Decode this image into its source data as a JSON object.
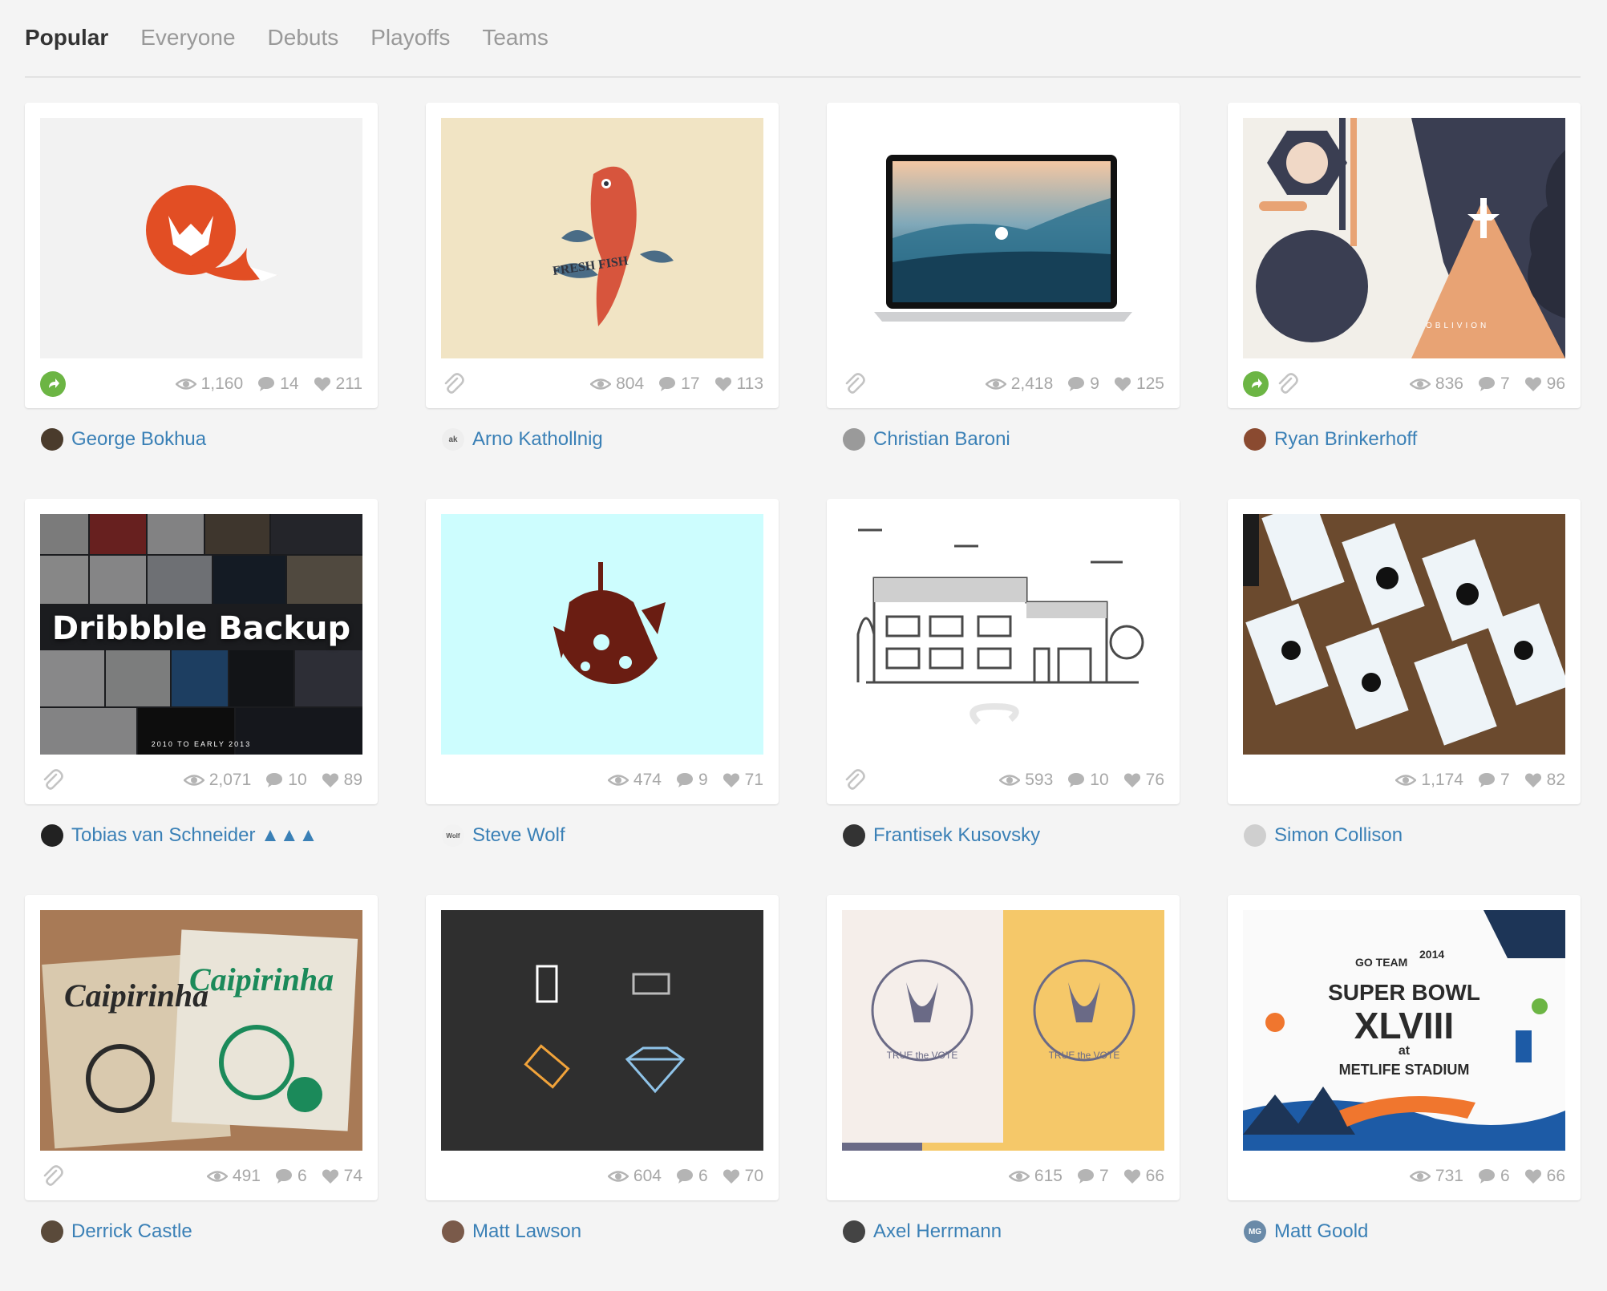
{
  "nav": {
    "tabs": [
      {
        "label": "Popular",
        "active": true
      },
      {
        "label": "Everyone"
      },
      {
        "label": "Debuts"
      },
      {
        "label": "Playoffs"
      },
      {
        "label": "Teams"
      }
    ]
  },
  "shots": [
    {
      "player": "George Bokhua",
      "views": "1,160",
      "comments": "14",
      "likes": "211",
      "rebound": true,
      "attachment": false,
      "avatar_color": "#4a3b2c"
    },
    {
      "player": "Arno Kathollnig",
      "views": "804",
      "comments": "17",
      "likes": "113",
      "rebound": false,
      "attachment": true,
      "avatar_color": "#eeeeee",
      "avatar_text": "ak"
    },
    {
      "player": "Christian Baroni",
      "views": "2,418",
      "comments": "9",
      "likes": "125",
      "rebound": false,
      "attachment": true,
      "avatar_color": "#9a9a9a"
    },
    {
      "player": "Ryan Brinkerhoff",
      "views": "836",
      "comments": "7",
      "likes": "96",
      "rebound": true,
      "attachment": true,
      "avatar_color": "#8a4a30"
    },
    {
      "player": "Tobias van Schneider ▲▲▲",
      "views": "2,071",
      "comments": "10",
      "likes": "89",
      "rebound": false,
      "attachment": true,
      "avatar_color": "#222222",
      "overlay_text": "Dribbble Backup"
    },
    {
      "player": "Steve Wolf",
      "views": "474",
      "comments": "9",
      "likes": "71",
      "rebound": false,
      "attachment": false,
      "avatar_color": "#f2f2f2",
      "avatar_text": "Wolf"
    },
    {
      "player": "Frantisek Kusovsky",
      "views": "593",
      "comments": "10",
      "likes": "76",
      "rebound": false,
      "attachment": true,
      "avatar_color": "#333333"
    },
    {
      "player": "Simon Collison",
      "views": "1,174",
      "comments": "7",
      "likes": "82",
      "rebound": false,
      "attachment": false,
      "avatar_color": "#cfcfcf"
    },
    {
      "player": "Derrick Castle",
      "views": "491",
      "comments": "6",
      "likes": "74",
      "rebound": false,
      "attachment": true,
      "avatar_color": "#5a4a3a"
    },
    {
      "player": "Matt Lawson",
      "views": "604",
      "comments": "6",
      "likes": "70",
      "rebound": false,
      "attachment": false,
      "avatar_color": "#7a5a4a"
    },
    {
      "player": "Axel Herrmann",
      "views": "615",
      "comments": "7",
      "likes": "66",
      "rebound": false,
      "attachment": false,
      "avatar_color": "#444444"
    },
    {
      "player": "Matt Goold",
      "views": "731",
      "comments": "6",
      "likes": "66",
      "rebound": false,
      "attachment": false,
      "avatar_color": "#6a8aa8",
      "avatar_text": "MG"
    }
  ],
  "artwork": {
    "fresh_fish_text": "FRESH FISH",
    "oblivion_text": "OBLIVION",
    "backup_years": "2010 TO EARLY 2013",
    "true_vote_text": "TRUE the VOTE",
    "superbowl_lines": [
      "SUPER BOWL",
      "XLVIII",
      "at",
      "METLIFE STADIUM",
      "GO TEAM",
      "2014"
    ],
    "caipirinha_text": "Caipirinha"
  },
  "colors": {
    "link": "#3a80b6",
    "meta": "#a7a7a7",
    "rebound": "#6cb544",
    "fox": "#e24e24"
  }
}
